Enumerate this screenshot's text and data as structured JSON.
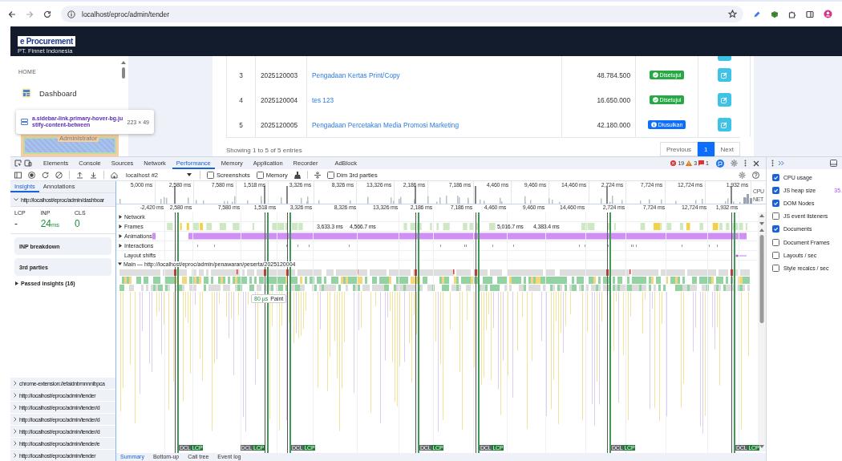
{
  "browser": {
    "url": "localhost/eproc/admin/tender"
  },
  "app": {
    "logo": "e Procurement",
    "company": "PT. Finnet Indonesia",
    "sidebar": {
      "section": "HOME",
      "items": [
        {
          "label": "Dashboard"
        }
      ],
      "user_role": "Administrator"
    },
    "inspect_tooltip": {
      "selector": "a.sidebar-link.primary-hover-bg.justify-content-between",
      "size": "223 × 49"
    },
    "table": {
      "rows": [
        {
          "no": "3",
          "code": "2025120003",
          "name": "Pengadaan Kertas Print/Copy",
          "amount": "48.784.500",
          "status": {
            "label": "Disetujui",
            "kind": "approved"
          }
        },
        {
          "no": "4",
          "code": "2025120004",
          "name": "tes 123",
          "amount": "16.650.000",
          "status": {
            "label": "Disetujui",
            "kind": "approved"
          }
        },
        {
          "no": "5",
          "code": "2025120005",
          "name": "Pengadaan Percetakan Media Promosi Marketing",
          "amount": "42.180.000",
          "status": {
            "label": "Diusulkan",
            "kind": "proposed"
          }
        }
      ]
    },
    "entries_info": "Showing 1 to 5 of 5 entries",
    "pagination": [
      {
        "label": "Previous",
        "selected": false
      },
      {
        "label": "1",
        "selected": true
      },
      {
        "label": "Next",
        "selected": false
      }
    ]
  },
  "devtools": {
    "tabs": [
      {
        "label": "Elements",
        "selected": false
      },
      {
        "label": "Console",
        "selected": false
      },
      {
        "label": "Sources",
        "selected": false
      },
      {
        "label": "Network",
        "selected": false
      },
      {
        "label": "Performance",
        "selected": true
      },
      {
        "label": "Memory",
        "selected": false
      },
      {
        "label": "Application",
        "selected": false
      },
      {
        "label": "Recorder",
        "selected": false
      },
      {
        "label": "AdBlock",
        "selected": false
      }
    ],
    "issues": {
      "errors": "19",
      "warnings": "3",
      "messages": "1"
    },
    "toolbar": {
      "recording": "localhost #2",
      "options": [
        {
          "label": "Screenshots",
          "checked": false
        },
        {
          "label": "Memory",
          "checked": false
        },
        {
          "label": "Dim 3rd parties",
          "checked": false
        }
      ]
    },
    "insights": {
      "tabs": [
        {
          "label": "Insights",
          "selected": true
        },
        {
          "label": "Annotations",
          "selected": false
        }
      ],
      "page_url": "http://localhost/eproc/admin/dashboar",
      "metrics": [
        {
          "name": "LCP",
          "value": "-"
        },
        {
          "name": "INP",
          "value": "24",
          "unit": "ms",
          "color": "#1e8e3e"
        },
        {
          "name": "CLS",
          "value": "0",
          "color": "#1e8e3e"
        }
      ],
      "cards": [
        "INP breakdown",
        "3rd parties"
      ],
      "passed": "Passed insights (16)",
      "pages": [
        "chrome-extension://efaidnbmnnnibpca",
        "http://localhost/eproc/admin/tender",
        "http://localhost/eproc/admin/tender/d",
        "http://localhost/eproc/admin/tender/d",
        "http://localhost/eproc/admin/tender/d",
        "http://localhost/eproc/admin/tender/e",
        "http://localhost/eproc/admin/tender"
      ]
    },
    "timeline": {
      "overview_ticks": [
        "5,000 ms",
        "2,580 ms",
        "7,580 ms",
        "1,518 ms",
        "3,326 ms",
        "8,326 ms",
        "13,326 ms",
        "2,186 ms",
        "7,186 ms",
        "4,460 ms",
        "9,460 ms",
        "14,460 ms",
        "2,724 ms",
        "7,724 ms",
        "12,724 ms",
        "1,932 ms"
      ],
      "overview_labels": [
        "CPU",
        "NET"
      ],
      "ticks": [
        "-2,420 ms",
        "2,580 ms",
        "7,580 ms",
        "1,518 ms",
        "3,326 ms",
        "8,326 ms",
        "13,326 ms",
        "2,186 ms",
        "7,186 ms",
        "4,460 ms",
        "9,460 ms",
        "14,460 ms",
        "2,724 ms",
        "7,724 ms",
        "12,724 ms",
        "1,932 ms"
      ],
      "tracks": [
        {
          "label": "Network",
          "expandable": true
        },
        {
          "label": "Frames",
          "expandable": true
        },
        {
          "label": "Animations",
          "expandable": true
        },
        {
          "label": "Interactions",
          "expandable": true
        },
        {
          "label": "Layout shifts",
          "expandable": false
        }
      ],
      "frame_labels": [
        "3,633.3 ms",
        "4,566.7 ms",
        "5,016.7 ms",
        "4,383.4 ms"
      ],
      "main_thread": {
        "label": "Main — http://localhost/eproc/admin/penawaran/peserta/2025120004",
        "expanded": true
      },
      "markers": [
        {
          "dcl": "DCL",
          "lcp": "LCP"
        },
        {
          "dcl": "DCL",
          "lcp": "LCP"
        },
        {
          "dcl": "DCL",
          "lcp": "LCP"
        },
        {
          "dcl": "DCL",
          "lcp": "LCP"
        },
        {
          "dcl": "DCL",
          "lcp": "LCP"
        },
        {
          "dcl": "DCL",
          "lcp": "LCP"
        },
        {
          "dcl": "DCL",
          "lcp": "LCP"
        }
      ],
      "tooltip": {
        "duration": "80 µs",
        "event": "Paint"
      }
    },
    "bottom_tabs": [
      {
        "label": "Summary",
        "selected": true
      },
      {
        "label": "Bottom-up",
        "selected": false
      },
      {
        "label": "Call tree",
        "selected": false
      },
      {
        "label": "Event log",
        "selected": false
      }
    ]
  },
  "drawer": {
    "options": [
      {
        "label": "CPU usage",
        "checked": true
      },
      {
        "label": "JS heap size",
        "checked": true,
        "reading": "35."
      },
      {
        "label": "DOM Nodes",
        "checked": true
      },
      {
        "label": "JS event listeners",
        "checked": false
      },
      {
        "label": "Documents",
        "checked": true
      },
      {
        "label": "Document Frames",
        "checked": false
      },
      {
        "label": "Layouts / sec",
        "checked": false
      },
      {
        "label": "Style recalcs / sec",
        "checked": false
      }
    ]
  }
}
